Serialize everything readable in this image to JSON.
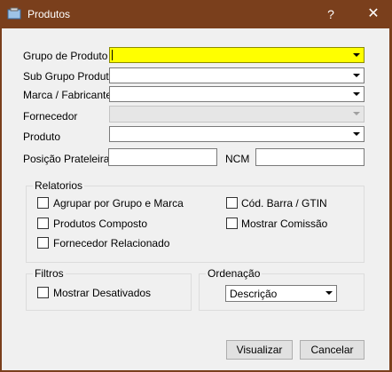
{
  "window": {
    "title": "Produtos",
    "help_label": "?",
    "close_label": "✕"
  },
  "fields": {
    "grupo_produto": {
      "label": "Grupo de Produto",
      "value": ""
    },
    "sub_grupo": {
      "label": "Sub Grupo Produto",
      "value": ""
    },
    "marca": {
      "label": "Marca / Fabricante",
      "value": ""
    },
    "fornecedor": {
      "label": "Fornecedor",
      "value": ""
    },
    "produto": {
      "label": "Produto",
      "value": ""
    },
    "posicao": {
      "label": "Posição Prateleira",
      "value": ""
    },
    "ncm": {
      "label": "NCM",
      "value": ""
    }
  },
  "relatorios": {
    "title": "Relatorios",
    "options": [
      "Agrupar por Grupo e Marca",
      "Produtos Composto",
      "Fornecedor Relacionado",
      "Cód. Barra / GTIN",
      "Mostrar Comissão"
    ]
  },
  "filtros": {
    "title": "Filtros",
    "mostrar_desativados": "Mostrar Desativados"
  },
  "ordenacao": {
    "title": "Ordenação",
    "selected": "Descrição"
  },
  "buttons": {
    "visualizar": "Visualizar",
    "cancelar": "Cancelar"
  },
  "colors": {
    "titlebar": "#7a3f1c",
    "highlight_field": "#ffff00"
  }
}
